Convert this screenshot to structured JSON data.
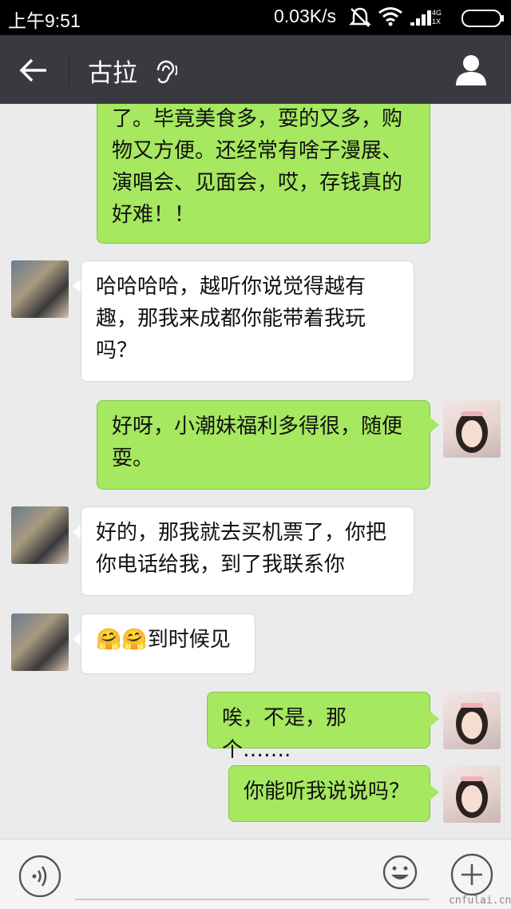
{
  "status_bar": {
    "time": "上午9:51",
    "net_speed": "0.03K/s",
    "network": "4G 1X",
    "icons": [
      "mute-icon",
      "wifi-icon",
      "signal-icon",
      "battery-icon"
    ]
  },
  "header": {
    "title": "古拉",
    "back_icon": "back-arrow-icon",
    "voice_mode_icon": "earpiece-icon",
    "profile_icon": "profile-icon"
  },
  "messages": [
    {
      "from": "me",
      "lines": [
        "了。毕竟美食多，耍的又多，购",
        "物又方便。还经常有啥子漫展、",
        "演唱会、见面会，哎，存钱真的",
        "好难！！"
      ]
    },
    {
      "from": "friend",
      "lines": [
        "哈哈哈哈，越听你说觉得越有",
        "趣，那我来成都你能带着我玩",
        "吗？"
      ]
    },
    {
      "from": "me",
      "lines": [
        "好呀，小潮妹福利多得很，随便",
        "耍。"
      ]
    },
    {
      "from": "friend",
      "lines": [
        "好的，那我就去买机票了，你把",
        "你电话给我，到了我联系你"
      ]
    },
    {
      "from": "friend",
      "lines": [
        "🤗🤗到时候见"
      ]
    },
    {
      "from": "me",
      "lines": [
        "唉，不是，那个……."
      ]
    },
    {
      "from": "me",
      "lines": [
        "你能听我说说吗？"
      ]
    }
  ],
  "input_bar": {
    "voice_icon": "voice-input-icon",
    "emoji_icon": "emoji-icon",
    "plus_icon": "plus-icon"
  },
  "watermark": "cnfulai.cn",
  "colors": {
    "header_bg": "#393a3f",
    "my_bubble": "#a6e860",
    "friend_bubble": "#ffffff",
    "chat_bg": "#ebebeb"
  }
}
